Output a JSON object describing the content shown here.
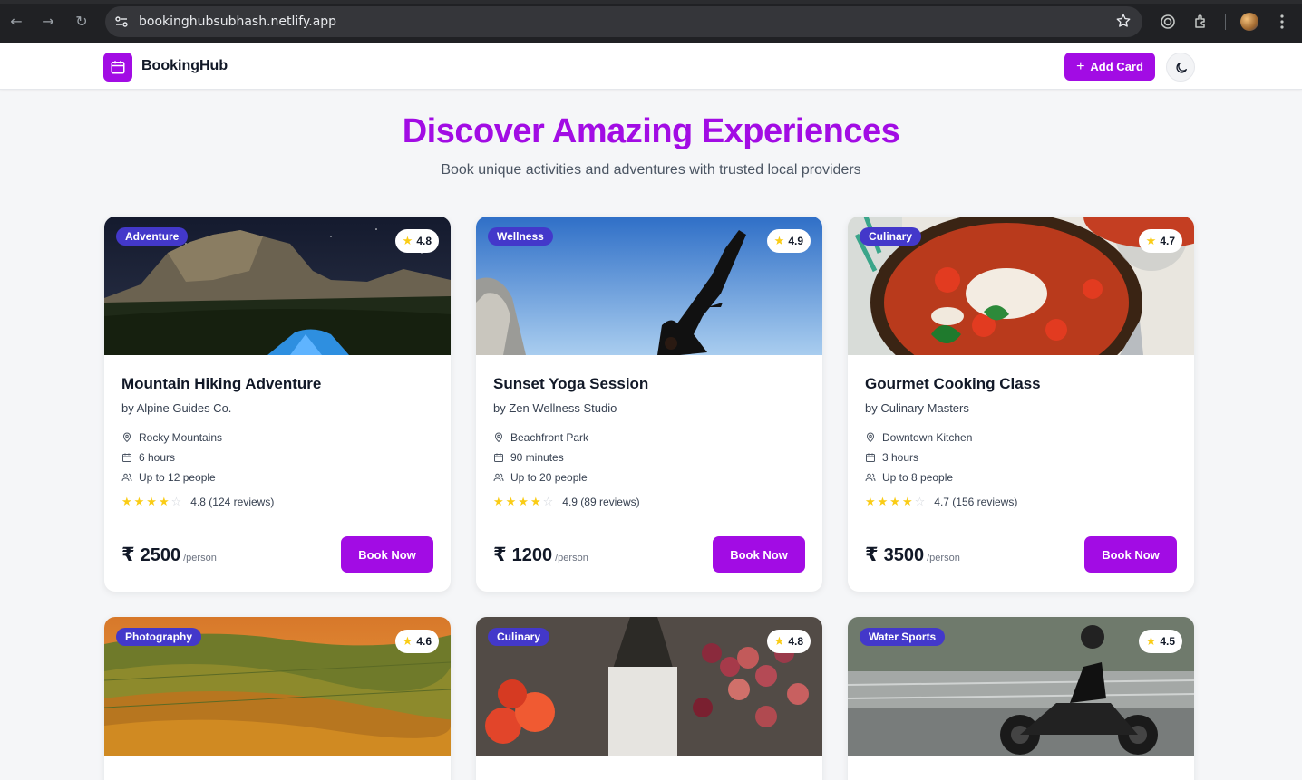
{
  "browser": {
    "url": "bookinghubsubhash.netlify.app"
  },
  "navbar": {
    "brand": "BookingHub",
    "add_card_label": "Add Card",
    "brand_color": "#a20ce4"
  },
  "hero": {
    "title": "Discover Amazing Experiences",
    "subtitle": "Book unique activities and adventures with trusted local providers"
  },
  "cards": [
    {
      "category": "Adventure",
      "rating": "4.8",
      "title": "Mountain Hiking Adventure",
      "provider": "by Alpine Guides Co.",
      "location": "Rocky Mountains",
      "duration": "6 hours",
      "capacity": "Up to 12 people",
      "reviews": "4.8 (124 reviews)",
      "stars_filled": 4,
      "currency": "₹",
      "price": "2500",
      "per": "/person",
      "book_label": "Book Now"
    },
    {
      "category": "Wellness",
      "rating": "4.9",
      "title": "Sunset Yoga Session",
      "provider": "by Zen Wellness Studio",
      "location": "Beachfront Park",
      "duration": "90 minutes",
      "capacity": "Up to 20 people",
      "reviews": "4.9 (89 reviews)",
      "stars_filled": 4,
      "currency": "₹",
      "price": "1200",
      "per": "/person",
      "book_label": "Book Now"
    },
    {
      "category": "Culinary",
      "rating": "4.7",
      "title": "Gourmet Cooking Class",
      "provider": "by Culinary Masters",
      "location": "Downtown Kitchen",
      "duration": "3 hours",
      "capacity": "Up to 8 people",
      "reviews": "4.7 (156 reviews)",
      "stars_filled": 4,
      "currency": "₹",
      "price": "3500",
      "per": "/person",
      "book_label": "Book Now"
    },
    {
      "category": "Photography",
      "rating": "4.6"
    },
    {
      "category": "Culinary",
      "rating": "4.8"
    },
    {
      "category": "Water Sports",
      "rating": "4.5"
    }
  ]
}
